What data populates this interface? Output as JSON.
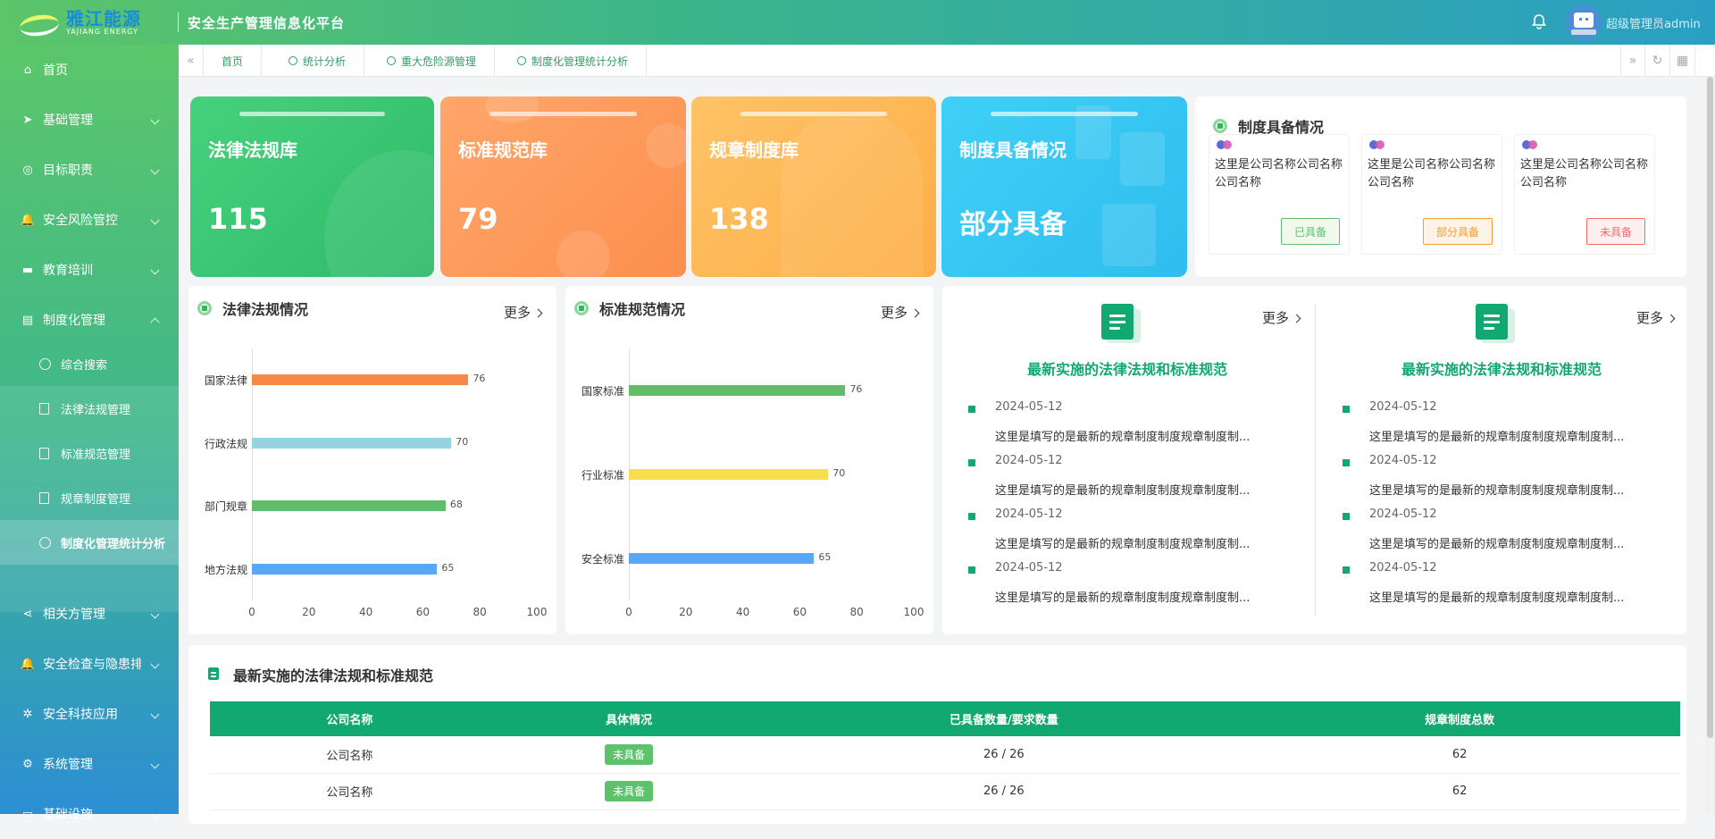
{
  "header": {
    "logo_cn": "雅江能源",
    "logo_en": "YAJIANG ENERGY",
    "system_title": "安全生产管理信息化平台",
    "username": "超级管理员admin"
  },
  "sidebar": {
    "items": [
      {
        "label": "首页",
        "icon": "home-icon"
      },
      {
        "label": "基础管理",
        "icon": "send-icon"
      },
      {
        "label": "目标职责",
        "icon": "target-icon"
      },
      {
        "label": "安全风险管控",
        "icon": "bell-icon"
      },
      {
        "label": "教育培训",
        "icon": "training-icon"
      },
      {
        "label": "制度化管理",
        "icon": "document-icon"
      },
      {
        "label": "相关方管理",
        "icon": "share-icon"
      },
      {
        "label": "安全检查与隐患排查",
        "icon": "bell-icon"
      },
      {
        "label": "安全科技应用",
        "icon": "tech-icon"
      },
      {
        "label": "系统管理",
        "icon": "gear-icon"
      },
      {
        "label": "基础设施",
        "icon": "monitor-icon"
      }
    ],
    "sub_items": [
      {
        "label": "综合搜索",
        "icon": "search-icon"
      },
      {
        "label": "法律法规管理",
        "icon": "copy-icon"
      },
      {
        "label": "标准规范管理",
        "icon": "file-icon"
      },
      {
        "label": "规章制度管理",
        "icon": "file-icon"
      },
      {
        "label": "制度化管理统计分析",
        "icon": "chart-icon"
      }
    ]
  },
  "tabs": [
    "首页",
    "统计分析",
    "重大危险源管理",
    "制度化管理统计分析"
  ],
  "stat_cards": [
    {
      "title": "法律法规库",
      "value": "115",
      "color": "#3ec573"
    },
    {
      "title": "标准规范库",
      "value": "79",
      "color": "#fd9a5a"
    },
    {
      "title": "规章制度库",
      "value": "138",
      "color": "#fdb955"
    },
    {
      "title": "制度具备情况",
      "value": "部分具备",
      "color": "#3cc7f3"
    }
  ],
  "readiness": {
    "title": "制度具备情况",
    "companies": [
      {
        "name": "这里是公司名称公司名称公司名称",
        "status": "已具备",
        "status_color": "#5cc36c"
      },
      {
        "name": "这里是公司名称公司名称公司名称",
        "status": "部分具备",
        "status_color": "#f59a3a"
      },
      {
        "name": "这里是公司名称公司名称公司名称",
        "status": "未具备",
        "status_color": "#f56c6c"
      }
    ]
  },
  "more_label": "更多",
  "chart_laws": {
    "title": "法律法规情况",
    "chart_data": {
      "type": "bar",
      "orientation": "horizontal",
      "categories": [
        "国家法律",
        "行政法规",
        "部门规章",
        "地方法规"
      ],
      "values": [
        76,
        70,
        68,
        65
      ],
      "colors": [
        "#f5894a",
        "#93d4df",
        "#62bd6a",
        "#59a8f5"
      ],
      "xlim": [
        0,
        100
      ],
      "xticks": [
        "0",
        "20",
        "40",
        "60",
        "80",
        "100"
      ]
    }
  },
  "chart_standards": {
    "title": "标准规范情况",
    "chart_data": {
      "type": "bar",
      "orientation": "horizontal",
      "categories": [
        "国家标准",
        "行业标准",
        "安全标准"
      ],
      "values": [
        76,
        70,
        65
      ],
      "colors": [
        "#62bd6a",
        "#f8dd4e",
        "#59a8f5"
      ],
      "xlim": [
        0,
        100
      ],
      "xticks": [
        "0",
        "20",
        "40",
        "60",
        "80",
        "100"
      ]
    }
  },
  "news_columns": [
    {
      "title": "最新实施的法律法规和标准规范",
      "items": [
        {
          "date": "2024-05-12",
          "text": "这里是填写的是最新的规章制度制度规章制度制..."
        },
        {
          "date": "2024-05-12",
          "text": "这里是填写的是最新的规章制度制度规章制度制..."
        },
        {
          "date": "2024-05-12",
          "text": "这里是填写的是最新的规章制度制度规章制度制..."
        },
        {
          "date": "2024-05-12",
          "text": "这里是填写的是最新的规章制度制度规章制度制..."
        }
      ]
    },
    {
      "title": "最新实施的法律法规和标准规范",
      "items": [
        {
          "date": "2024-05-12",
          "text": "这里是填写的是最新的规章制度制度规章制度制..."
        },
        {
          "date": "2024-05-12",
          "text": "这里是填写的是最新的规章制度制度规章制度制..."
        },
        {
          "date": "2024-05-12",
          "text": "这里是填写的是最新的规章制度制度规章制度制..."
        },
        {
          "date": "2024-05-12",
          "text": "这里是填写的是最新的规章制度制度规章制度制..."
        }
      ]
    }
  ],
  "table": {
    "title": "最新实施的法律法规和标准规范",
    "columns": [
      "公司名称",
      "具体情况",
      "已具备数量/要求数量",
      "规章制度总数"
    ],
    "rows": [
      {
        "company": "公司名称",
        "status": "未具备",
        "ratio": "26 / 26",
        "total": "62"
      },
      {
        "company": "公司名称",
        "status": "未具备",
        "ratio": "26 / 26",
        "total": "62"
      }
    ]
  }
}
